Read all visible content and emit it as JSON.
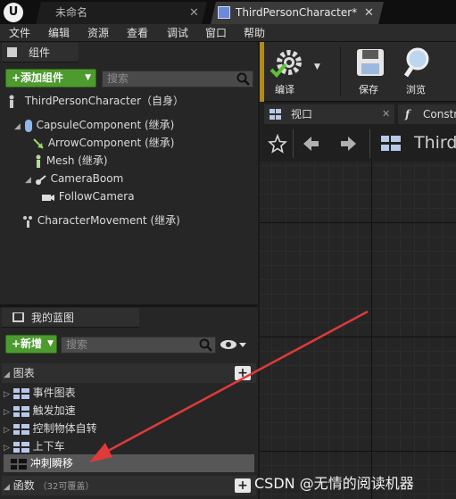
{
  "titlebar": {
    "tabs": [
      {
        "label": "未命名",
        "close": "✕"
      },
      {
        "label": "ThirdPersonCharacter*",
        "close": "✕"
      }
    ]
  },
  "menubar": {
    "items": [
      "文件",
      "编辑",
      "资源",
      "查看",
      "调试",
      "窗口",
      "帮助"
    ]
  },
  "components_panel": {
    "tab_label": "组件",
    "add_button": "+添加组件",
    "search_placeholder": "搜索",
    "root": "ThirdPersonCharacter（自身）",
    "items": [
      {
        "label": "CapsuleComponent (继承)"
      },
      {
        "label": "ArrowComponent (继承)"
      },
      {
        "label": "Mesh (继承)"
      },
      {
        "label": "CameraBoom"
      },
      {
        "label": "FollowCamera"
      },
      {
        "label": "CharacterMovement (继承)"
      }
    ]
  },
  "blueprint_panel": {
    "tab_label": "我的蓝图",
    "add_button": "+新增",
    "search_placeholder": "搜索",
    "graphs_header": "图表",
    "graphs": [
      {
        "label": "事件图表"
      },
      {
        "label": "触发加速"
      },
      {
        "label": "控制物体自转"
      },
      {
        "label": "上下车"
      },
      {
        "label": "冲刺瞬移"
      }
    ],
    "functions_header": "函数",
    "functions_count": "（32可覆盖）"
  },
  "toolbar": {
    "compile_label": "编译",
    "save_label": "保存",
    "browse_label": "浏览"
  },
  "editor_tabs": {
    "viewport": "视口",
    "construction": "Constr"
  },
  "graph_nav": {
    "title": "Third"
  },
  "watermark": "CSDN @无情的阅读机器",
  "colors": {
    "accent_green": "#4d9a2f",
    "annotation_arrow": "#e03a3a"
  }
}
